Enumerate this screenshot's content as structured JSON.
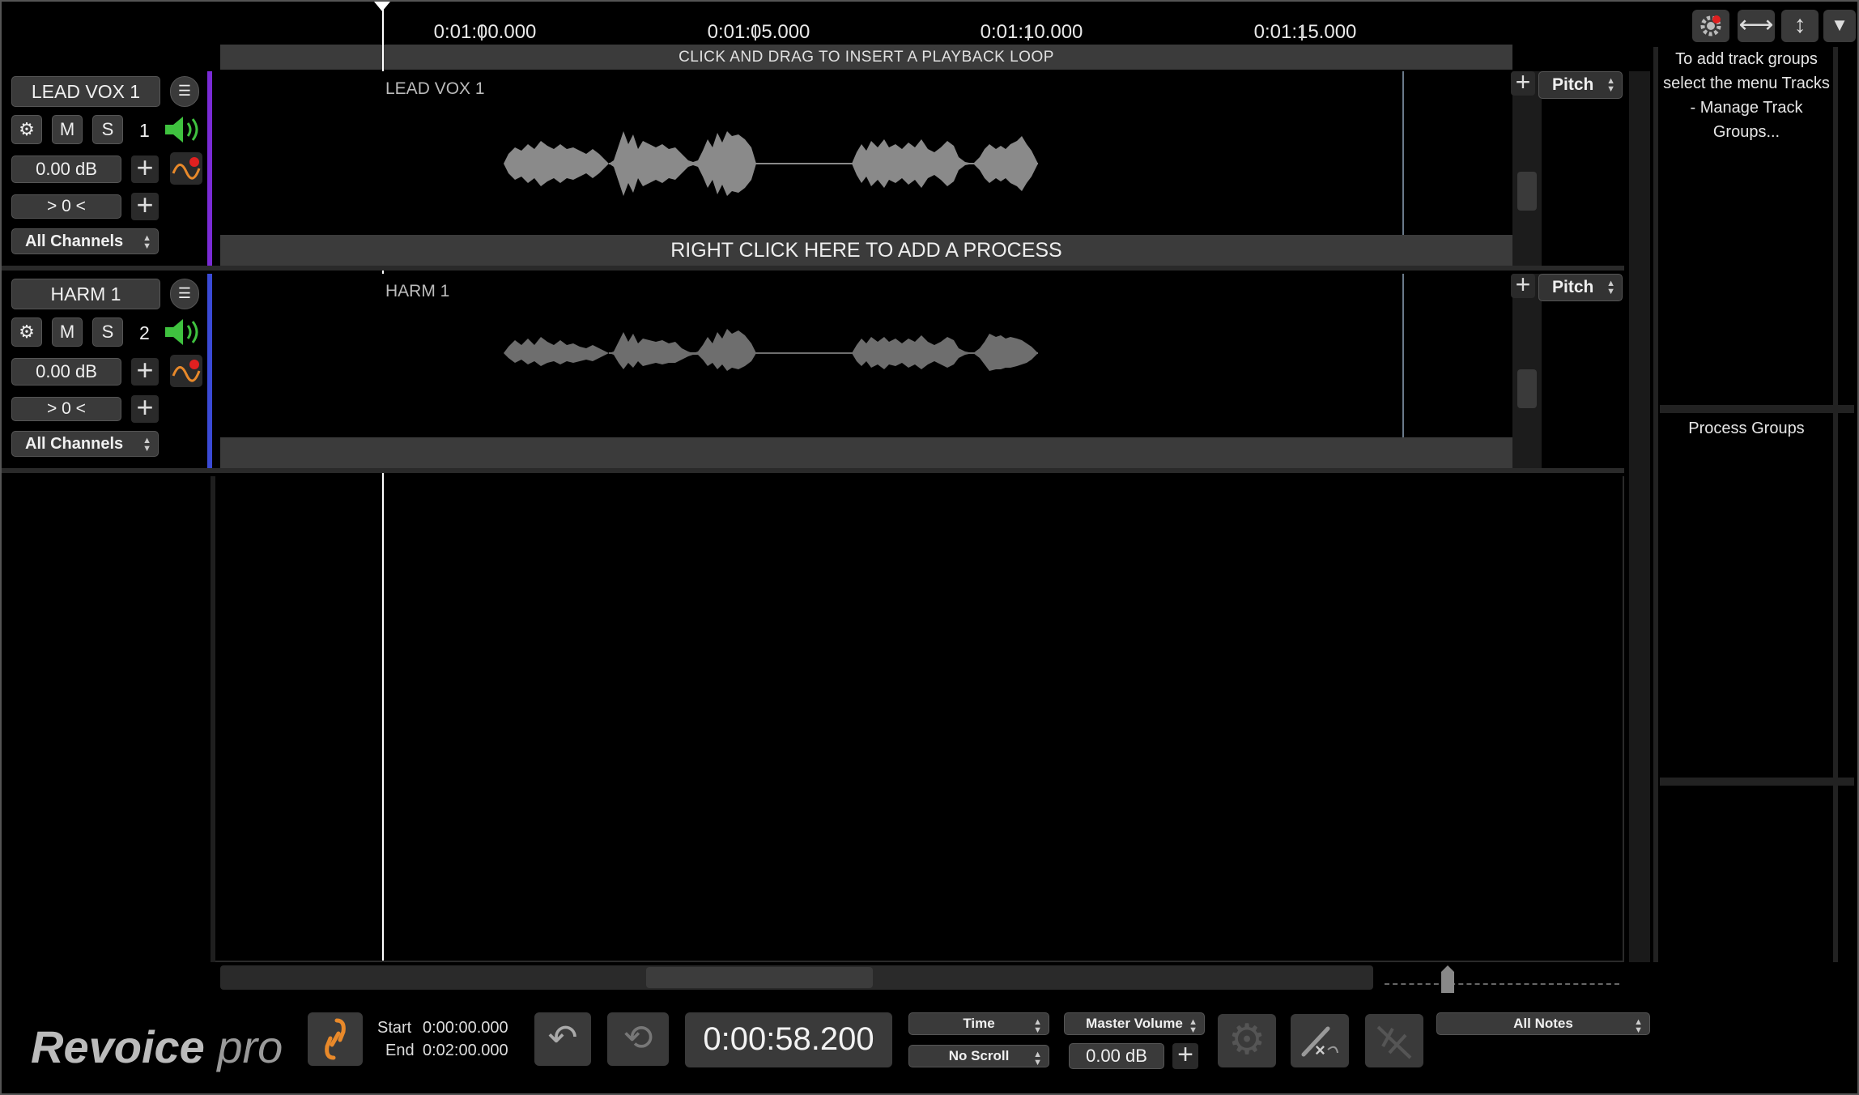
{
  "ruler": {
    "labels": [
      "0:01:00.000",
      "0:01:05.000",
      "0:01:10.000",
      "0:01:15.000"
    ],
    "loop_hint": "CLICK AND DRAG TO INSERT A PLAYBACK LOOP"
  },
  "tracks": [
    {
      "name": "LEAD VOX 1",
      "number": "1",
      "mute": "M",
      "solo": "S",
      "gain": "0.00 dB",
      "pan": "> 0 <",
      "channels": "All Channels",
      "lane_label": "LEAD VOX 1",
      "process_hint": "RIGHT CLICK HERE TO ADD A PROCESS",
      "process_select": "Pitch",
      "color": "#7a2bd6"
    },
    {
      "name": "HARM 1",
      "number": "2",
      "mute": "M",
      "solo": "S",
      "gain": "0.00 dB",
      "pan": "> 0 <",
      "channels": "All Channels",
      "lane_label": "HARM 1",
      "process_hint": "",
      "process_select": "Pitch",
      "color": "#3a4ad6"
    }
  ],
  "right_panel": {
    "track_groups_hint": "To add track groups select the menu Tracks - Manage Track Groups...",
    "process_groups_title": "Process Groups"
  },
  "bottom": {
    "logo_main": "Revoice",
    "logo_sub": "pro",
    "start_label": "Start",
    "start_value": "0:00:00.000",
    "end_label": "End",
    "end_value": "0:02:00.000",
    "time_display": "0:00:58.200",
    "time_mode": "Time",
    "scroll_mode": "No Scroll",
    "master_label": "Master Volume",
    "master_value": "0.00 dB",
    "notes_select": "All Notes"
  },
  "colors": {
    "accent_orange": "#e8892a",
    "speaker_green": "#3fc23f",
    "record_red": "#e02020"
  }
}
